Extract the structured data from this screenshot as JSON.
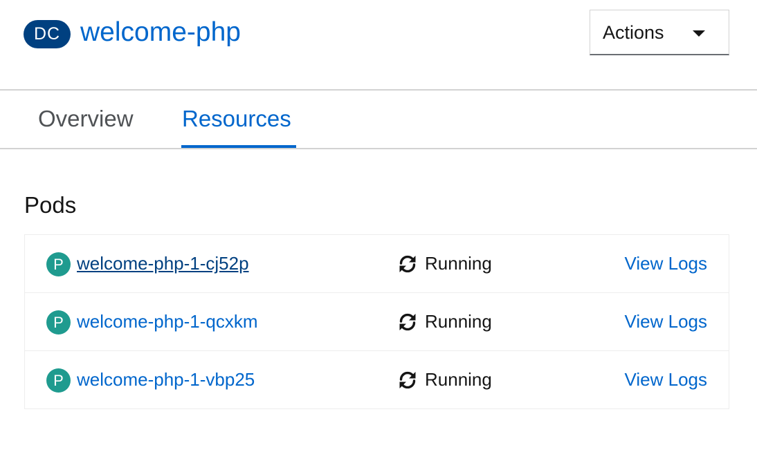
{
  "header": {
    "badge": "DC",
    "title": "welcome-php",
    "actions_label": "Actions"
  },
  "tabs": [
    {
      "label": "Overview",
      "active": false
    },
    {
      "label": "Resources",
      "active": true
    }
  ],
  "pods_section": {
    "title": "Pods",
    "pods": [
      {
        "badge": "P",
        "name": "welcome-php-1-cj52p",
        "status": "Running",
        "logs_label": "View Logs"
      },
      {
        "badge": "P",
        "name": "welcome-php-1-qcxkm",
        "status": "Running",
        "logs_label": "View Logs"
      },
      {
        "badge": "P",
        "name": "welcome-php-1-vbp25",
        "status": "Running",
        "logs_label": "View Logs"
      }
    ]
  },
  "colors": {
    "link": "#0066cc",
    "visited_link": "#004080",
    "dc_badge": "#004080",
    "pod_badge": "#1f9b8f",
    "border": "#d2d2d2"
  },
  "icons": {
    "actions_caret": "caret-down-icon",
    "pod_status": "sync-icon"
  }
}
